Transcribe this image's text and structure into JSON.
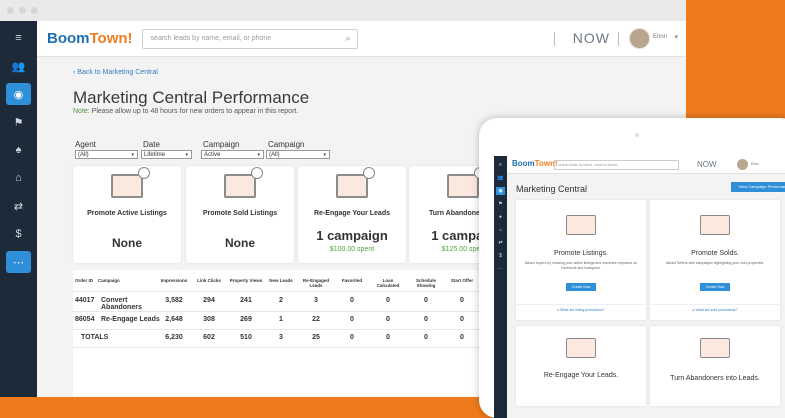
{
  "app": {
    "logo_a": "Boom",
    "logo_b": "Town!",
    "search_placeholder": "search leads by name, email, or phone",
    "now": "NOW",
    "user": "Erinn"
  },
  "sidebar": {
    "items": [
      "≡",
      "👥",
      "◉",
      "⚑",
      "♠",
      "⌂",
      "⇄",
      "$",
      "⋯"
    ]
  },
  "page": {
    "back": "‹ Back to Marketing Central",
    "title": "Marketing Central Performance",
    "note_a": "Note:",
    "note_b": " Please allow up to 48 hours for new orders to appear in this report."
  },
  "filters": [
    {
      "label": "Agent",
      "value": "(All)"
    },
    {
      "label": "Date Range",
      "value": "Lifetime"
    },
    {
      "label": "Campaign Status",
      "value": "Active"
    },
    {
      "label": "Campaign Type",
      "value": "(All)"
    }
  ],
  "cards": [
    {
      "title": "Promote Active Listings",
      "value": "None",
      "sub": ""
    },
    {
      "title": "Promote Sold Listings",
      "value": "None",
      "sub": ""
    },
    {
      "title": "Re-Engage Your Leads",
      "value": "1 campaign",
      "sub": "$100.00 spent"
    },
    {
      "title": "Turn Abandoners Int",
      "value": "1 campaig",
      "sub": "$125.00 spen"
    }
  ],
  "table": {
    "headers": [
      "Order ID",
      "Campaign",
      "Impressions",
      "Link Clicks",
      "Property Views",
      "New Leads",
      "Re-Engaged Leads",
      "Favorited",
      "Loan Calculated",
      "Schedule Showing",
      "Start Offer"
    ],
    "rows": [
      [
        "44017",
        "Convert Abandoners",
        "3,582",
        "294",
        "241",
        "2",
        "3",
        "0",
        "0",
        "0",
        "0"
      ],
      [
        "86054",
        "Re-Engage Leads",
        "2,648",
        "308",
        "269",
        "1",
        "22",
        "0",
        "0",
        "0",
        "0"
      ],
      [
        "TOTALS",
        "",
        "6,230",
        "602",
        "510",
        "3",
        "25",
        "0",
        "0",
        "0",
        "0"
      ]
    ]
  },
  "tablet": {
    "logo_a": "Boom",
    "logo_b": "Town!",
    "search": "search leads by name, email or phone",
    "now": "NOW",
    "user": "Erinn",
    "title": "Marketing Central",
    "button": "View Campaign Performance",
    "cards": [
      {
        "title": "Promote Listings.",
        "desc": "Attract buyers by showing your active listings and maximize exposure on Facebook and Instagram.",
        "btn": "Create Now",
        "link": "▸ What are listing promotions?"
      },
      {
        "title": "Promote Solds.",
        "desc": "Attract Sellers with campaigns highlighting your sold properties.",
        "btn": "Create Now",
        "link": "▸ What are sold promotions?"
      },
      {
        "title": "Re-Engage Your Leads.",
        "desc": "",
        "btn": "",
        "link": ""
      },
      {
        "title": "Turn Abandoners into Leads.",
        "desc": "",
        "btn": "",
        "link": ""
      }
    ]
  }
}
